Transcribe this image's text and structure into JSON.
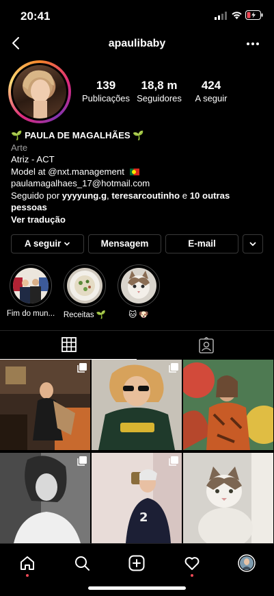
{
  "status_bar": {
    "time": "20:41"
  },
  "header": {
    "username": "apaulibaby"
  },
  "profile": {
    "stats": [
      {
        "value": "139",
        "label": "Publicações"
      },
      {
        "value": "18,8 m",
        "label": "Seguidores"
      },
      {
        "value": "424",
        "label": "A seguir"
      }
    ]
  },
  "bio": {
    "name_emoji_left": "🌱",
    "name": "PAULA DE MAGALHÃES",
    "name_emoji_right": "🌱",
    "category": "Arte",
    "line1": "Atriz - ACT",
    "line2_prefix": "Model at ",
    "line2_mention": "@nxt.management",
    "email": "paulamagalhaes_17@hotmail.com",
    "followed_prefix": "Seguido por ",
    "followed_user1": "yyyyung.g",
    "followed_sep": ", ",
    "followed_user2": "teresarcoutinho",
    "followed_and": " e ",
    "followed_others": "10 outras pessoas",
    "translate": "Ver tradução"
  },
  "buttons": {
    "following": "A seguir",
    "message": "Mensagem",
    "email": "E-mail"
  },
  "highlights": [
    {
      "caption": "Fim do mun..."
    },
    {
      "caption": "Receitas 🌱"
    },
    {
      "caption": "🐱 🐶"
    }
  ],
  "colors": {
    "accent_red": "#ed4956",
    "border": "#3a3a3a",
    "muted_text": "#9c9c9c"
  }
}
